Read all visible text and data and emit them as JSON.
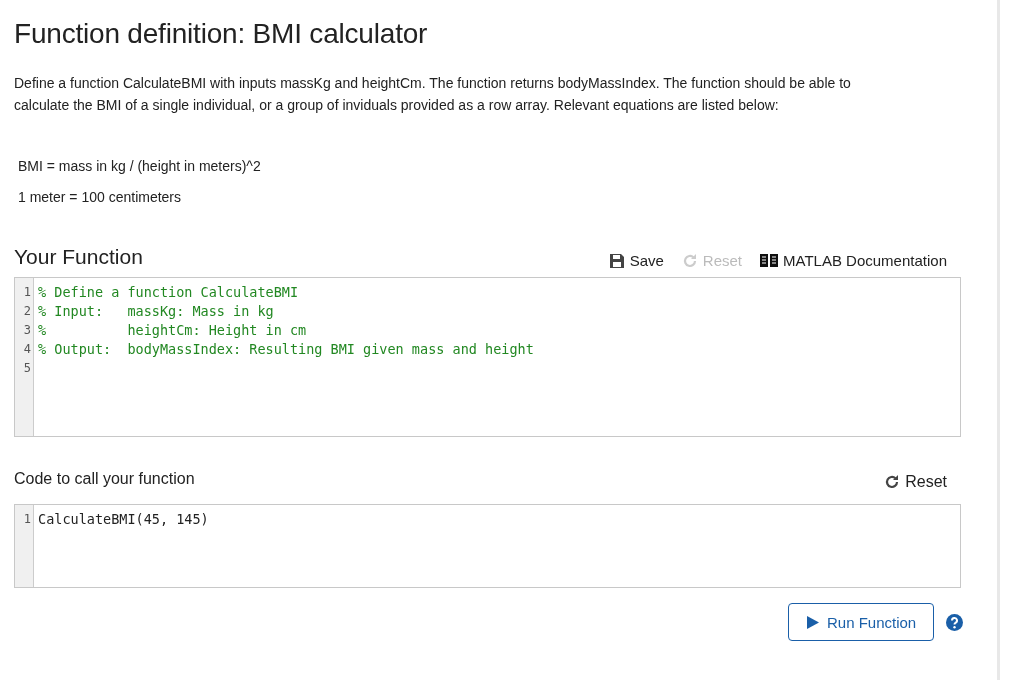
{
  "title": "Function definition: BMI calculator",
  "description": "Define a function CalculateBMI with inputs massKg and heightCm. The function returns bodyMassIndex. The function should be able to calculate the BMI of a single individual, or a group of inviduals provided as a row array. Relevant equations are listed below:",
  "equations": [
    "BMI = mass in kg / (height in meters)^2",
    "1 meter = 100 centimeters"
  ],
  "function_section": {
    "heading": "Your Function",
    "toolbar": [
      {
        "kind": "save",
        "label": "Save",
        "disabled": false
      },
      {
        "kind": "reset",
        "label": "Reset",
        "disabled": true
      },
      {
        "kind": "docs",
        "label": "MATLAB Documentation",
        "disabled": false
      }
    ],
    "editor": {
      "lines": [
        {
          "number": "1",
          "code": "% Define a function CalculateBMI"
        },
        {
          "number": "2",
          "code": "% Input:   massKg: Mass in kg"
        },
        {
          "number": "3",
          "code": "%          heightCm: Height in cm"
        },
        {
          "number": "4",
          "code": "% Output:  bodyMassIndex: Resulting BMI given mass and height"
        },
        {
          "number": "5"
        }
      ]
    }
  },
  "call_section": {
    "heading": "Code to call your function",
    "reset": {
      "label": "Reset",
      "disabled": false
    },
    "editor": {
      "lines": [
        {
          "number": "1",
          "code": "CalculateBMI(45, 145)"
        }
      ]
    }
  },
  "run_button": {
    "label": "Run Function"
  }
}
